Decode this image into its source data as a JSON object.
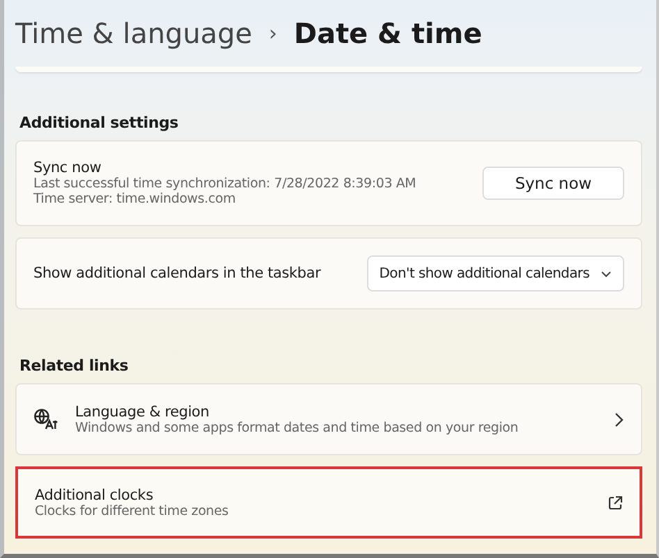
{
  "breadcrumb": {
    "parent": "Time & language",
    "separator": "›",
    "current": "Date & time"
  },
  "additional_settings": {
    "heading": "Additional settings",
    "sync": {
      "title": "Sync now",
      "lines": [
        "Last successful time synchronization: 7/28/2022 8:39:03 AM",
        "Time server: time.windows.com"
      ],
      "button": "Sync now"
    },
    "calendars": {
      "label": "Show additional calendars in the taskbar",
      "value": "Don't show additional calendars"
    }
  },
  "related_links": {
    "heading": "Related links",
    "items": [
      {
        "kind": "language",
        "title": "Language & region",
        "description": "Windows and some apps format dates and time based on your region",
        "highlighted": false
      },
      {
        "kind": "external",
        "title": "Additional clocks",
        "description": "Clocks for different time zones",
        "highlighted": true
      }
    ]
  }
}
